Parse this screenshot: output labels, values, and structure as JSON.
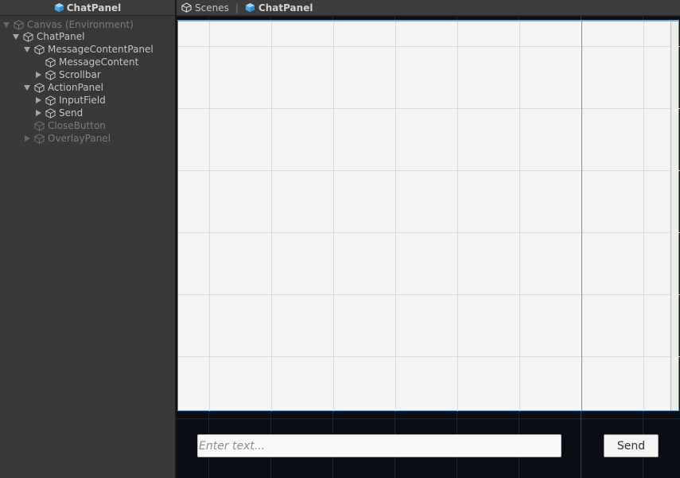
{
  "hierarchy": {
    "header_title": "ChatPanel",
    "items": [
      {
        "label": "Canvas (Environment)",
        "expander": "down",
        "enabled": false
      },
      {
        "label": "ChatPanel",
        "expander": "down",
        "enabled": true
      },
      {
        "label": "MessageContentPanel",
        "expander": "down",
        "enabled": true
      },
      {
        "label": "MessageContent",
        "expander": "none",
        "enabled": true
      },
      {
        "label": "Scrollbar",
        "expander": "right",
        "enabled": true
      },
      {
        "label": "ActionPanel",
        "expander": "down",
        "enabled": true
      },
      {
        "label": "InputField",
        "expander": "right",
        "enabled": true
      },
      {
        "label": "Send",
        "expander": "right",
        "enabled": true
      },
      {
        "label": "CloseButton",
        "expander": "none",
        "enabled": false
      },
      {
        "label": "OverlayPanel",
        "expander": "right",
        "enabled": false
      }
    ]
  },
  "scene": {
    "breadcrumb": {
      "scenes_label": "Scenes",
      "separator": "|",
      "prefab_label": "ChatPanel"
    },
    "input": {
      "placeholder": "Enter text..."
    },
    "send_label": "Send"
  },
  "colors": {
    "prefab_icon": "#5fb8f5",
    "panel_background": "#f4f4f4",
    "scene_background": "#0a0d14",
    "selection_outline": "#4d88c9"
  },
  "icons": {
    "prefab": "cube-icon",
    "unity_logo": "unity-logo-icon",
    "expand_open": "chevron-down-icon",
    "expand_closed": "chevron-right-icon"
  }
}
